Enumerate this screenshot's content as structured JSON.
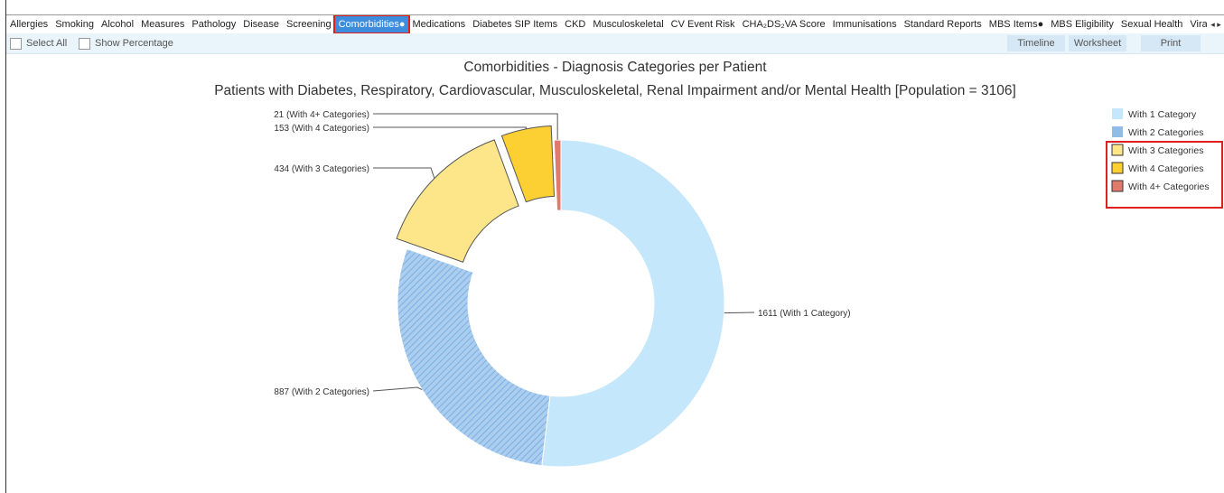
{
  "tabs": [
    {
      "label": "Allergies",
      "active": false
    },
    {
      "label": "Smoking",
      "active": false
    },
    {
      "label": "Alcohol",
      "active": false
    },
    {
      "label": "Measures",
      "active": false
    },
    {
      "label": "Pathology",
      "active": false
    },
    {
      "label": "Disease",
      "active": false
    },
    {
      "label": "Screening",
      "active": false
    },
    {
      "label": "Comorbidities●",
      "active": true
    },
    {
      "label": "Medications",
      "active": false
    },
    {
      "label": "Diabetes SIP Items",
      "active": false
    },
    {
      "label": "CKD",
      "active": false
    },
    {
      "label": "Musculoskeletal",
      "active": false
    },
    {
      "label": "CV Event Risk",
      "active": false
    },
    {
      "label": "CHA₂DS₂VA Score",
      "active": false
    },
    {
      "label": "Immunisations",
      "active": false
    },
    {
      "label": "Standard Reports",
      "active": false
    },
    {
      "label": "MBS Items●",
      "active": false
    },
    {
      "label": "MBS Eligibility",
      "active": false
    },
    {
      "label": "Sexual Health",
      "active": false
    },
    {
      "label": "Vira",
      "active": false
    }
  ],
  "tab_scroll": {
    "left": "◂",
    "right": "▸"
  },
  "toolbar": {
    "select_all": "Select All",
    "show_percentage": "Show Percentage",
    "timeline": "Timeline",
    "worksheet": "Worksheet",
    "print": "Print"
  },
  "colors": {
    "accent": "#3c8dde",
    "highlight": "#e02020",
    "toolbar_bg": "#e9f4fb"
  },
  "chart_data": {
    "type": "pie",
    "donut": true,
    "title": "Comorbidities - Diagnosis Categories per Patient",
    "subtitle": "Patients with Diabetes, Respiratory, Cardiovascular, Musculoskeletal, Renal Impairment and/or Mental Health [Population = 3106]",
    "slices": [
      {
        "name": "With 1 Category",
        "value": 1611,
        "label": "1611 (With 1 Category)",
        "color": "#c5e7fb",
        "exploded": false,
        "hatched": false
      },
      {
        "name": "With 2 Categories",
        "value": 887,
        "label": "887 (With 2 Categories)",
        "color": "#8fbde6",
        "exploded": false,
        "hatched": true
      },
      {
        "name": "With 3 Categories",
        "value": 434,
        "label": "434 (With 3 Categories)",
        "color": "#fde68a",
        "exploded": true,
        "hatched": false
      },
      {
        "name": "With 4 Categories",
        "value": 153,
        "label": "153 (With 4 Categories)",
        "color": "#fccf33",
        "exploded": true,
        "hatched": false
      },
      {
        "name": "With 4+ Categories",
        "value": 21,
        "label": "21 (With 4+ Categories)",
        "color": "#e07a6c",
        "exploded": false,
        "hatched": false
      }
    ],
    "legend": {
      "placement": "right",
      "highlighted": [
        "With 3 Categories",
        "With 4 Categories",
        "With 4+ Categories"
      ]
    }
  }
}
